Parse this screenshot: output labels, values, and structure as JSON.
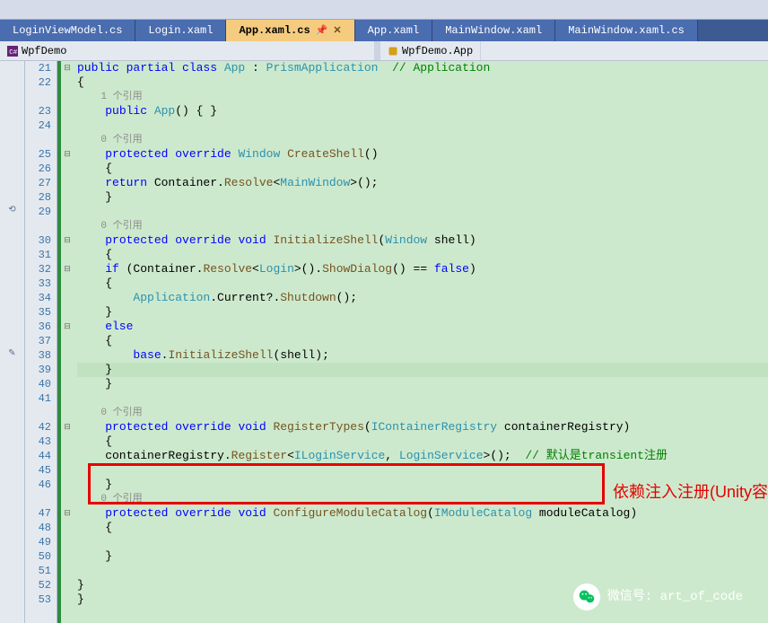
{
  "tabs": [
    "LoginViewModel.cs",
    "Login.xaml",
    "App.xaml.cs",
    "App.xaml",
    "MainWindow.xaml",
    "MainWindow.xaml.cs"
  ],
  "active_tab": "App.xaml.cs",
  "breadcrumb": {
    "project": "WpfDemo",
    "class": "WpfDemo.App"
  },
  "ref_hint": "0 个引用",
  "ref_hint_one": "1 个引用",
  "annotation": "依赖注入注册(Unity容器)",
  "wechat": {
    "label": "微信号: art_of_code"
  },
  "lines": {
    "start": 21,
    "end": 53
  },
  "code": {
    "l21_pre": "public partial class ",
    "l21_app": "App",
    "l21_colon": " : ",
    "l21_prism": "PrismApplication",
    "l21_comment": "  // Application",
    "l22": "{",
    "l23_pub": "public",
    "l23_app": " App",
    "l23_rest": "() { }",
    "l25_prot": "protected override ",
    "l25_win": "Window",
    "l25_m": " CreateShell",
    "l25_p": "()",
    "l26": "{",
    "l27_ret": "    return",
    "l27_cont": " Container.",
    "l27_res": "Resolve",
    "l27_lt": "<",
    "l27_mw": "MainWindow",
    "l27_gt": ">();",
    "l28": "}",
    "l30_prot": "protected override void",
    "l30_m": " InitializeShell",
    "l30_p": "(",
    "l30_win": "Window",
    "l30_arg": " shell)",
    "l31": "{",
    "l32_if": "    if",
    "l32_a": " (Container.",
    "l32_res": "Resolve",
    "l32_lt": "<",
    "l32_login": "Login",
    "l32_b": ">().",
    "l32_sd": "ShowDialog",
    "l32_c": "() == ",
    "l32_false": "false",
    "l32_d": ")",
    "l33": "    {",
    "l34_app": "        Application",
    "l34_rest": ".Current?.",
    "l34_sd": "Shutdown",
    "l34_end": "();",
    "l35": "    }",
    "l36_else": "    else",
    "l37": "    {",
    "l38_base": "        base",
    "l38_dot": ".",
    "l38_init": "InitializeShell",
    "l38_arg": "(shell);",
    "l39": "    }",
    "l40": "}",
    "l42_prot": "protected override void",
    "l42_m": " RegisterTypes",
    "l42_p": "(",
    "l42_icr": "IContainerRegistry",
    "l42_arg": " containerRegistry)",
    "l43": "{",
    "l44_a": "    containerRegistry.",
    "l44_reg": "Register",
    "l44_lt": "<",
    "l44_ils": "ILoginService",
    "l44_c": ", ",
    "l44_ls": "LoginService",
    "l44_gt": ">();",
    "l44_comment": "  // 默认是transient注册",
    "l46": "}",
    "l47_prot": "protected override void",
    "l47_m": " ConfigureModuleCatalog",
    "l47_p": "(",
    "l47_imc": "IModuleCatalog",
    "l47_arg": " moduleCatalog)",
    "l48": "{",
    "l50": "}",
    "l52": "}",
    "l53": "}"
  }
}
